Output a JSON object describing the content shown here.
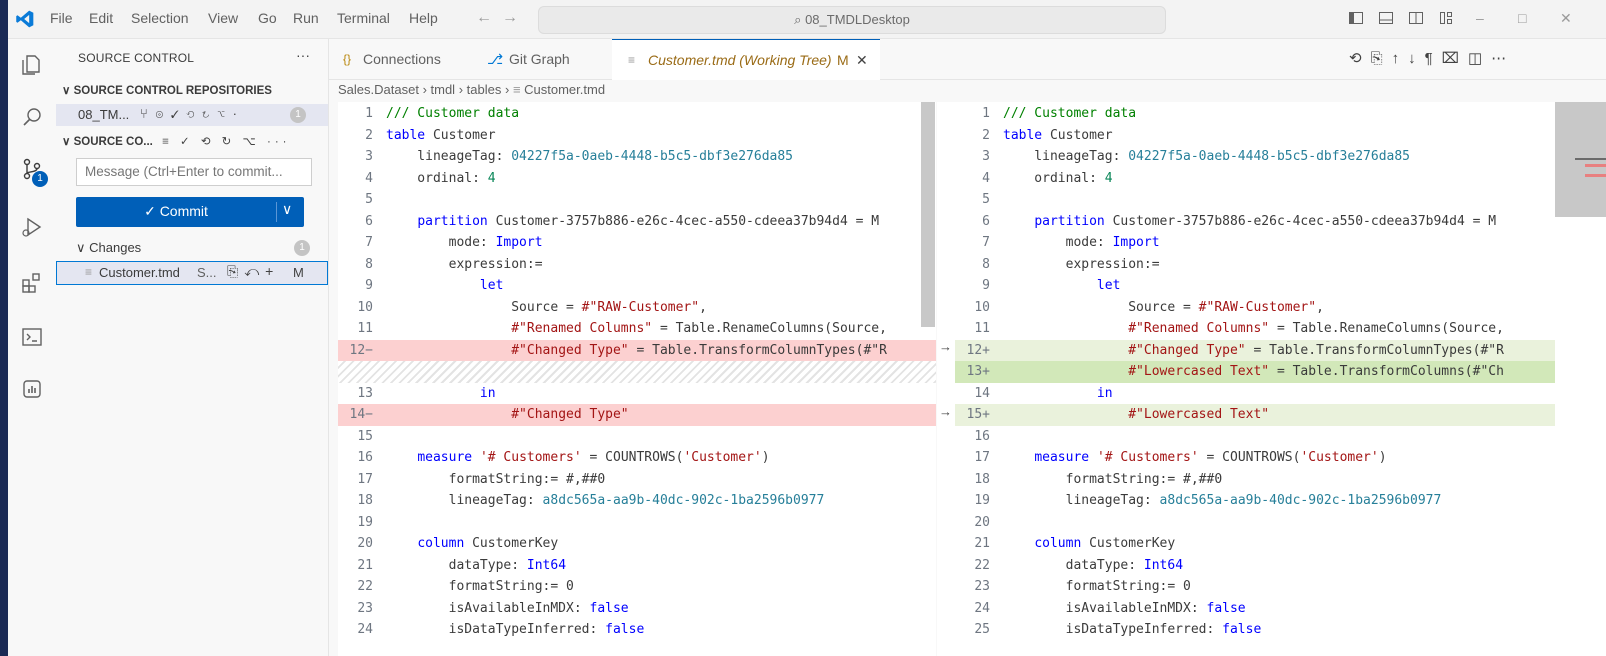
{
  "menu": [
    "File",
    "Edit",
    "Selection",
    "View",
    "Go",
    "Run",
    "Terminal",
    "Help"
  ],
  "search": {
    "text": "08_TMDLDesktop"
  },
  "sidebar": {
    "title": "SOURCE CONTROL",
    "repos_header": "SOURCE CONTROL REPOSITORIES",
    "repo_name": "08_TM...",
    "repo_badge": "1",
    "sc_header": "SOURCE CO...",
    "message_placeholder": "Message (Ctrl+Enter to commit...",
    "commit_label": "✓ Commit",
    "changes_label": "Changes",
    "changes_count": "1",
    "file_name": "Customer.tmd",
    "file_folder": "S...",
    "file_status": "M"
  },
  "activity": {
    "scm_badge": "1"
  },
  "tabs": [
    {
      "label": "Connections",
      "icon": "{}"
    },
    {
      "label": "Git Graph"
    },
    {
      "label": "Customer.tmd (Working Tree)",
      "status": "M"
    }
  ],
  "breadcrumb": [
    "Sales.Dataset",
    "tmdl",
    "tables",
    "Customer.tmd"
  ],
  "diff": {
    "left": [
      {
        "n": "1",
        "t": "/// Customer data",
        "cls": ""
      },
      {
        "n": "2",
        "t": "table Customer",
        "cls": ""
      },
      {
        "n": "3",
        "t": "    lineageTag: 04227f5a-0aeb-4448-b5c5-dbf3e276da85",
        "cls": ""
      },
      {
        "n": "4",
        "t": "    ordinal: 4",
        "cls": ""
      },
      {
        "n": "5",
        "t": "",
        "cls": ""
      },
      {
        "n": "6",
        "t": "    partition Customer-3757b886-e26c-4cec-a550-cdeea37b94d4 = M",
        "cls": ""
      },
      {
        "n": "7",
        "t": "        mode: Import",
        "cls": ""
      },
      {
        "n": "8",
        "t": "        expression:=",
        "cls": ""
      },
      {
        "n": "9",
        "t": "            let",
        "cls": ""
      },
      {
        "n": "10",
        "t": "                Source = #\"RAW-Customer\",",
        "cls": ""
      },
      {
        "n": "11",
        "t": "                #\"Renamed Columns\" = Table.RenameColumns(Source,",
        "cls": ""
      },
      {
        "n": "12−",
        "t": "                #\"Changed Type\" = Table.TransformColumnTypes(#\"R",
        "cls": "del"
      },
      {
        "n": "",
        "t": "",
        "cls": "hatch"
      },
      {
        "n": "13",
        "t": "            in",
        "cls": ""
      },
      {
        "n": "14−",
        "t": "                #\"Changed Type\"",
        "cls": "del"
      },
      {
        "n": "15",
        "t": "",
        "cls": ""
      },
      {
        "n": "16",
        "t": "    measure '# Customers' = COUNTROWS('Customer')",
        "cls": ""
      },
      {
        "n": "17",
        "t": "        formatString:= #,##0",
        "cls": ""
      },
      {
        "n": "18",
        "t": "        lineageTag: a8dc565a-aa9b-40dc-902c-1ba2596b0977",
        "cls": ""
      },
      {
        "n": "19",
        "t": "",
        "cls": ""
      },
      {
        "n": "20",
        "t": "    column CustomerKey",
        "cls": ""
      },
      {
        "n": "21",
        "t": "        dataType: Int64",
        "cls": ""
      },
      {
        "n": "22",
        "t": "        formatString:= 0",
        "cls": ""
      },
      {
        "n": "23",
        "t": "        isAvailableInMDX: false",
        "cls": ""
      },
      {
        "n": "24",
        "t": "        isDataTypeInferred: false",
        "cls": ""
      }
    ],
    "right": [
      {
        "n": "1",
        "t": "/// Customer data",
        "cls": ""
      },
      {
        "n": "2",
        "t": "table Customer",
        "cls": ""
      },
      {
        "n": "3",
        "t": "    lineageTag: 04227f5a-0aeb-4448-b5c5-dbf3e276da85",
        "cls": ""
      },
      {
        "n": "4",
        "t": "    ordinal: 4",
        "cls": ""
      },
      {
        "n": "5",
        "t": "",
        "cls": ""
      },
      {
        "n": "6",
        "t": "    partition Customer-3757b886-e26c-4cec-a550-cdeea37b94d4 = M",
        "cls": ""
      },
      {
        "n": "7",
        "t": "        mode: Import",
        "cls": ""
      },
      {
        "n": "8",
        "t": "        expression:=",
        "cls": ""
      },
      {
        "n": "9",
        "t": "            let",
        "cls": ""
      },
      {
        "n": "10",
        "t": "                Source = #\"RAW-Customer\",",
        "cls": ""
      },
      {
        "n": "11",
        "t": "                #\"Renamed Columns\" = Table.RenameColumns(Source,",
        "cls": ""
      },
      {
        "n": "12+",
        "t": "                #\"Changed Type\" = Table.TransformColumnTypes(#\"R",
        "cls": "ins"
      },
      {
        "n": "13+",
        "t": "                #\"Lowercased Text\" = Table.TransformColumns(#\"Ch",
        "cls": "ins2"
      },
      {
        "n": "14",
        "t": "            in",
        "cls": ""
      },
      {
        "n": "15+",
        "t": "                #\"Lowercased Text\"",
        "cls": "ins"
      },
      {
        "n": "16",
        "t": "",
        "cls": ""
      },
      {
        "n": "17",
        "t": "    measure '# Customers' = COUNTROWS('Customer')",
        "cls": ""
      },
      {
        "n": "18",
        "t": "        formatString:= #,##0",
        "cls": ""
      },
      {
        "n": "19",
        "t": "        lineageTag: a8dc565a-aa9b-40dc-902c-1ba2596b0977",
        "cls": ""
      },
      {
        "n": "20",
        "t": "",
        "cls": ""
      },
      {
        "n": "21",
        "t": "    column CustomerKey",
        "cls": ""
      },
      {
        "n": "22",
        "t": "        dataType: Int64",
        "cls": ""
      },
      {
        "n": "23",
        "t": "        formatString:= 0",
        "cls": ""
      },
      {
        "n": "24",
        "t": "        isAvailableInMDX: false",
        "cls": ""
      },
      {
        "n": "25",
        "t": "        isDataTypeInferred: false",
        "cls": ""
      }
    ]
  },
  "colors": {
    "accent": "#005fb8",
    "deleted": "#fcd0d0",
    "inserted": "#eaf2dc"
  }
}
